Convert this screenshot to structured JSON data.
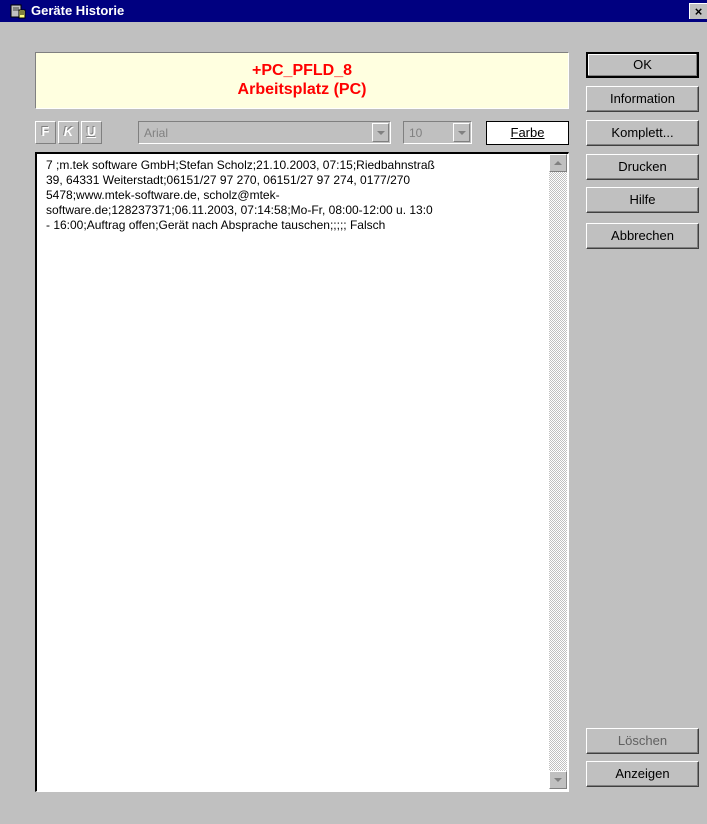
{
  "window": {
    "title": "Geräte Historie",
    "close_symbol": "×"
  },
  "header": {
    "line1": "+PC_PFLD_8",
    "line2": "Arbeitsplatz (PC)"
  },
  "toolbar": {
    "bold_label": "F",
    "italic_label": "K",
    "underline_label": "U",
    "font_name": "Arial",
    "font_size": "10",
    "color_button": "Farbe"
  },
  "buttons": {
    "ok": "OK",
    "information": "Information",
    "komplett": "Komplett...",
    "drucken": "Drucken",
    "hilfe": "Hilfe",
    "abbrechen": "Abbrechen",
    "loeschen": "Löschen",
    "anzeigen": "Anzeigen"
  },
  "text_content": {
    "lines": [
      "7 ;m.tek software GmbH;Stefan Scholz;21.10.2003, 07:15;Riedbahnstraß",
      "39, 64331 Weiterstadt;06151/27 97 270, 06151/27 97 274, 0177/270",
      "5478;www.mtek-software.de, scholz@mtek-",
      "software.de;128237371;06.11.2003, 07:14:58;Mo-Fr, 08:00-12:00 u. 13:0",
      "- 16:00;Auftrag offen;Gerät nach Absprache tauschen;;;;; Falsch"
    ]
  },
  "colors": {
    "title_bar": "#000080",
    "header_bg": "#ffffe0",
    "header_text": "#ff0000",
    "dialog_bg": "#c0c0c0"
  }
}
